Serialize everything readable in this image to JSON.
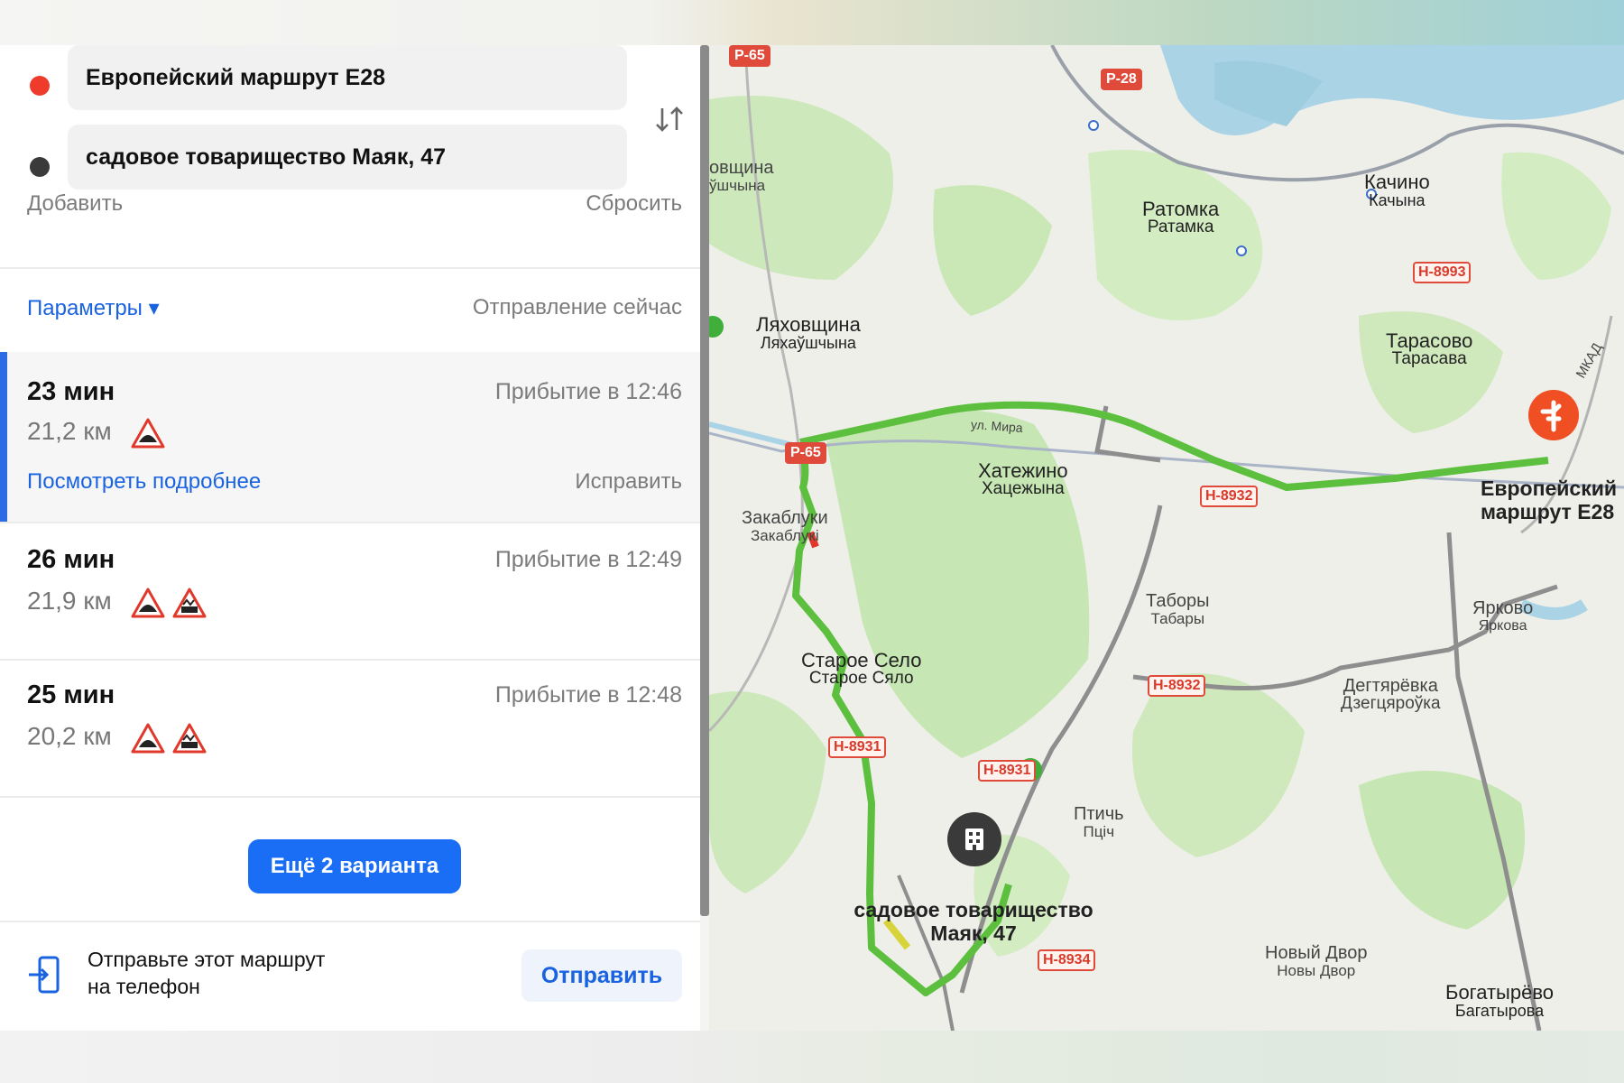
{
  "route_inputs": {
    "from": "Европейский маршрут E28",
    "to": "садовое товарищество Маяк, 47",
    "add_label": "Добавить",
    "reset_label": "Сбросить"
  },
  "params": {
    "label": "Параметры ▾",
    "departure": "Отправление сейчас"
  },
  "routes": [
    {
      "time": "23 мин",
      "arrival": "Прибытие в 12:46",
      "distance": "21,2 км",
      "details_link": "Посмотреть подробнее",
      "fix_label": "Исправить",
      "active": true
    },
    {
      "time": "26 мин",
      "arrival": "Прибытие в 12:49",
      "distance": "21,9 км",
      "active": false
    },
    {
      "time": "25 мин",
      "arrival": "Прибытие в 12:48",
      "distance": "20,2 км",
      "active": false
    }
  ],
  "more_button": "Ещё 2 варианта",
  "send": {
    "text_line1": "Отправьте этот маршрут",
    "text_line2": "на телефон",
    "button": "Отправить"
  },
  "map": {
    "places": {
      "ratomka": "Ратомка",
      "ratomka_by": "Ратамка",
      "kachino": "Качино",
      "kachino_by": "Качына",
      "lyakhovshchina": "Ляховщина",
      "lyakhovshchina_by": "Ляхаўшчына",
      "tarasovo": "Тарасово",
      "tarasovo_by": "Тарасава",
      "khatezhino": "Хатежино",
      "khatezhino_by": "Хацежына",
      "zakabluki": "Закаблуки",
      "zakabluki_by": "Закаблукі",
      "tabory": "Таборы",
      "tabory_by": "Табары",
      "yarkovo": "Ярково",
      "yarkovo_by": "Яркова",
      "staroe_selo": "Старое Село",
      "staroe_selo_by": "Старое Сяло",
      "dzegtsyarovka": "Дегтярёвка",
      "dzegtsyarovka_by": "Дзегцяроўка",
      "ptich": "Птичь",
      "ptich_by": "Пціч",
      "novy_dvor": "Новый Двор",
      "novy_dvor_by": "Новы Двор",
      "bogatyrevo": "Богатырёво",
      "bogatyrevo_by": "Багатырова",
      "ovshchina": "овщина",
      "ovshchina_by": "ўшчына",
      "mkad": "МКАД",
      "street_mira": "ул. Мира"
    },
    "roads": [
      "Р-65",
      "Р-28",
      "Н-8993",
      "Р-65",
      "Н-8932",
      "Н-8932",
      "Н-8931",
      "Н-8931",
      "Н-8934"
    ],
    "destination_label": "Европейский маршрут E28",
    "origin_label": "садовое товарищество Маяк, 47",
    "colors": {
      "route": "#5cbf3e",
      "forest": "#c6e6b3",
      "water": "#aad3e6",
      "road": "#8e8e8e",
      "pin_end": "#f04e23",
      "pin_start": "#3a3a3a"
    }
  }
}
